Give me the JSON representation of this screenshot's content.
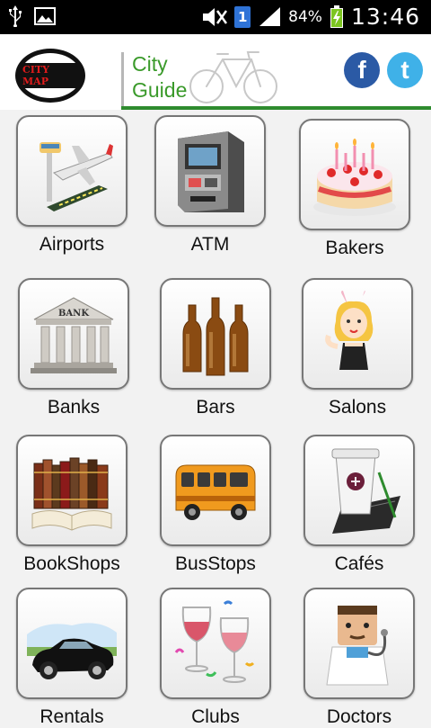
{
  "status_bar": {
    "battery_percent": "84%",
    "time": "13:46",
    "sim_badge": "1",
    "icons": [
      "usb-icon",
      "image-icon",
      "mute-icon",
      "sim-icon",
      "signal-icon",
      "battery-icon"
    ]
  },
  "header": {
    "logo_text": "CITY MAP",
    "title_line1": "City",
    "title_line2": "Guide",
    "accent_color": "#2e8b2e",
    "facebook_letter": "f",
    "twitter_letter": "t"
  },
  "categories": [
    {
      "label": "Airports",
      "icon": "airport-icon"
    },
    {
      "label": "ATM",
      "icon": "atm-icon"
    },
    {
      "label": "Bakers",
      "icon": "cake-icon"
    },
    {
      "label": "Banks",
      "icon": "bank-icon"
    },
    {
      "label": "Bars",
      "icon": "beer-bottles-icon"
    },
    {
      "label": "Salons",
      "icon": "salon-girl-icon"
    },
    {
      "label": "BookShops",
      "icon": "books-icon"
    },
    {
      "label": "BusStops",
      "icon": "bus-icon"
    },
    {
      "label": "Cafés",
      "icon": "coffee-cup-icon"
    },
    {
      "label": "Rentals",
      "icon": "car-icon"
    },
    {
      "label": "Clubs",
      "icon": "wine-glasses-icon"
    },
    {
      "label": "Doctors",
      "icon": "doctor-icon"
    }
  ]
}
